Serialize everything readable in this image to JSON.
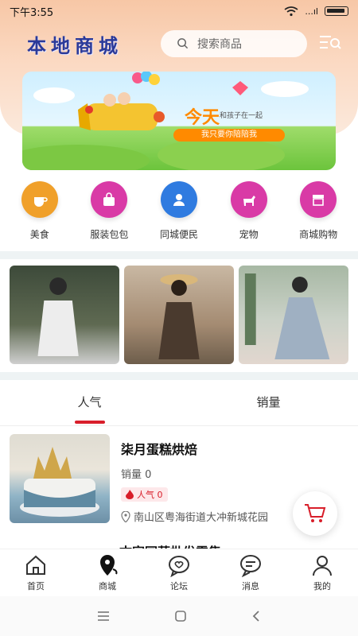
{
  "status_bar": {
    "time": "下午3:55",
    "signal": "...ıl"
  },
  "header": {
    "app_title": "本地商城",
    "search_placeholder": "搜索商品"
  },
  "banner": {
    "title": "今天",
    "line1": "和孩子在一起",
    "line2": "我只要你陪陪我"
  },
  "categories": [
    {
      "label": "美食",
      "icon": "cup-icon",
      "color": "#f0a02a"
    },
    {
      "label": "服装包包",
      "icon": "bag-icon",
      "color": "#d93aa6"
    },
    {
      "label": "同城便民",
      "icon": "people-icon",
      "color": "#2f7be0"
    },
    {
      "label": "宠物",
      "icon": "dog-icon",
      "color": "#d93aa6"
    },
    {
      "label": "商城购物",
      "icon": "shop-icon",
      "color": "#d93aa6"
    }
  ],
  "tabs": [
    {
      "label": "人气",
      "active": true
    },
    {
      "label": "销量",
      "active": false
    }
  ],
  "product": {
    "name": "柒月蛋糕烘焙",
    "sales": "销量 0",
    "hot": "人气 0",
    "address": "南山区粤海街道大冲新城花园"
  },
  "next_product": {
    "name_partial": "古家园蔬批发零售"
  },
  "bottom_nav": [
    {
      "label": "首页",
      "icon": "home-icon"
    },
    {
      "label": "商城",
      "icon": "location-icon"
    },
    {
      "label": "论坛",
      "icon": "forum-heart-icon"
    },
    {
      "label": "消息",
      "icon": "message-icon"
    },
    {
      "label": "我的",
      "icon": "user-icon"
    }
  ],
  "colors": {
    "accent": "#d81e2a",
    "title": "#2b3a99"
  }
}
